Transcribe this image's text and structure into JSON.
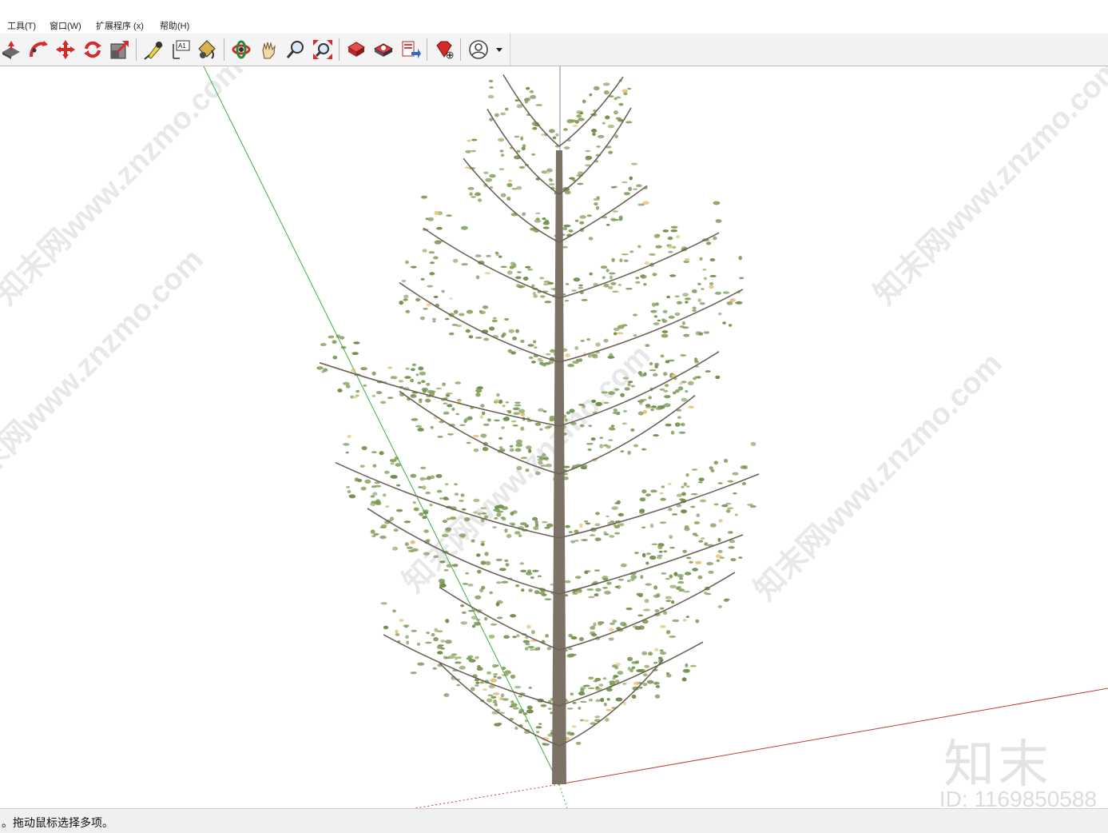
{
  "menu": {
    "items": [
      "工具(T)",
      "窗口(W)",
      "扩展程序 (x)",
      "帮助(H)"
    ]
  },
  "toolbar": {
    "buttons": [
      {
        "icon": "push-pull-icon",
        "tooltip": ""
      },
      {
        "icon": "follow-me-icon",
        "tooltip": ""
      },
      {
        "icon": "move-icon",
        "tooltip": ""
      },
      {
        "icon": "rotate-icon",
        "tooltip": ""
      },
      {
        "icon": "scale-icon",
        "tooltip": ""
      },
      {
        "icon": "tape-measure-icon",
        "tooltip": ""
      },
      {
        "icon": "text-icon",
        "label": "A1"
      },
      {
        "icon": "paint-bucket-icon",
        "tooltip": ""
      },
      {
        "icon": "orbit-icon",
        "tooltip": ""
      },
      {
        "icon": "pan-icon",
        "tooltip": ""
      },
      {
        "icon": "zoom-icon",
        "tooltip": ""
      },
      {
        "icon": "zoom-extents-icon",
        "tooltip": ""
      },
      {
        "icon": "warehouse-icon",
        "tooltip": ""
      },
      {
        "icon": "share-model-icon",
        "tooltip": ""
      },
      {
        "icon": "upload-icon",
        "tooltip": ""
      },
      {
        "icon": "extension-warehouse-icon",
        "tooltip": ""
      },
      {
        "icon": "account-icon",
        "tooltip": ""
      }
    ],
    "text_tool_label": "A1"
  },
  "status": {
    "text": "。拖动鼠标选择多项。"
  },
  "watermark": {
    "text": "知末网www.znzmo.com",
    "logo": "知末",
    "id": "ID: 1169850588"
  },
  "colors": {
    "green_axis": "#3cb043",
    "red_axis": "#c23a3a",
    "blue_axis": "#8a8aa8",
    "foliage": "#6f8f4a",
    "trunk": "#7d7266"
  }
}
